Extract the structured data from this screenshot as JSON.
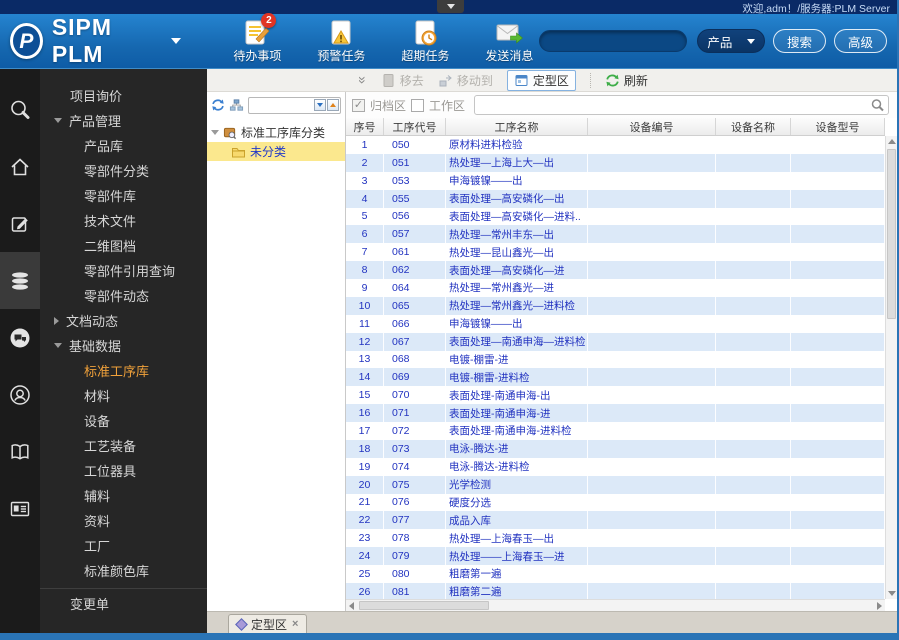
{
  "titlebar": {
    "welcome": "欢迎,adm！/服务器:PLM Server"
  },
  "header": {
    "brand": "SIPM PLM",
    "actions": [
      {
        "name": "todo",
        "label": "待办事项",
        "badge": "2"
      },
      {
        "name": "warning-tasks",
        "label": "预警任务"
      },
      {
        "name": "overdue-tasks",
        "label": "超期任务"
      },
      {
        "name": "send-message",
        "label": "发送消息"
      }
    ],
    "search": {
      "value": "",
      "category": "产品",
      "search_btn": "搜索",
      "advanced_btn": "高级"
    }
  },
  "nav_rail": {
    "active": "database",
    "icons": [
      "sipm-search",
      "home",
      "edit",
      "database",
      "chat",
      "support",
      "book",
      "id-card"
    ]
  },
  "sidebar": {
    "active_item": "标准工序库",
    "items": [
      {
        "label": "项目询价",
        "type": "top"
      },
      {
        "label": "产品管理",
        "type": "group",
        "state": "expanded"
      },
      {
        "label": "产品库",
        "type": "child"
      },
      {
        "label": "零部件分类",
        "type": "child"
      },
      {
        "label": "零部件库",
        "type": "child"
      },
      {
        "label": "技术文件",
        "type": "child"
      },
      {
        "label": "二维图档",
        "type": "child"
      },
      {
        "label": "零部件引用查询",
        "type": "child"
      },
      {
        "label": "零部件动态",
        "type": "child"
      },
      {
        "label": "文档动态",
        "type": "group",
        "state": "collapsed"
      },
      {
        "label": "基础数据",
        "type": "group",
        "state": "expanded"
      },
      {
        "label": "标准工序库",
        "type": "child"
      },
      {
        "label": "材料",
        "type": "child"
      },
      {
        "label": "设备",
        "type": "child"
      },
      {
        "label": "工艺装备",
        "type": "child"
      },
      {
        "label": "工位器具",
        "type": "child"
      },
      {
        "label": "辅料",
        "type": "child"
      },
      {
        "label": "资料",
        "type": "child"
      },
      {
        "label": "工厂",
        "type": "child"
      },
      {
        "label": "标准颜色库",
        "type": "child"
      },
      {
        "label": "变更单",
        "type": "top",
        "separator": true
      }
    ]
  },
  "toolbar": {
    "buttons": [
      {
        "label": "移去",
        "enabled": false
      },
      {
        "label": "移动到",
        "enabled": false
      },
      {
        "label": "定型区",
        "enabled": true,
        "active": true
      },
      {
        "label": "刷新",
        "enabled": true
      }
    ],
    "filters": {
      "archive": {
        "label": "归档区",
        "checked": true,
        "enabled": false
      },
      "workspace": {
        "label": "工作区",
        "checked": false,
        "enabled": true
      }
    }
  },
  "tree": {
    "root": "标准工序库分类",
    "children": [
      {
        "label": "未分类",
        "selected": true
      }
    ]
  },
  "table": {
    "columns": [
      "序号",
      "工序代号",
      "工序名称",
      "设备编号",
      "设备名称",
      "设备型号"
    ],
    "rows": [
      [
        "1",
        "050",
        "原材料进料检验"
      ],
      [
        "2",
        "051",
        "热处理—上海上大—出"
      ],
      [
        "3",
        "053",
        "申海镀镍——出"
      ],
      [
        "4",
        "055",
        "表面处理—高安磷化—出"
      ],
      [
        "5",
        "056",
        "表面处理—高安磷化—进料.."
      ],
      [
        "6",
        "057",
        "热处理—常州丰东—出"
      ],
      [
        "7",
        "061",
        "热处理—昆山鑫光—出"
      ],
      [
        "8",
        "062",
        "表面处理—高安磷化—进"
      ],
      [
        "9",
        "064",
        "热处理—常州鑫光—进"
      ],
      [
        "10",
        "065",
        "热处理—常州鑫光—进料检"
      ],
      [
        "11",
        "066",
        "申海镀镍——出"
      ],
      [
        "12",
        "067",
        "表面处理—南通申海—进料检"
      ],
      [
        "13",
        "068",
        "电镀-棚雷-进"
      ],
      [
        "14",
        "069",
        "电镀-棚雷-进料检"
      ],
      [
        "15",
        "070",
        "表面处理-南通申海-出"
      ],
      [
        "16",
        "071",
        "表面处理-南通申海-进"
      ],
      [
        "17",
        "072",
        "表面处理-南通申海-进料检"
      ],
      [
        "18",
        "073",
        "电泳-腾达-进"
      ],
      [
        "19",
        "074",
        "电泳-腾达-进料检"
      ],
      [
        "20",
        "075",
        "光学检测"
      ],
      [
        "21",
        "076",
        "硬度分选"
      ],
      [
        "22",
        "077",
        "成品入库"
      ],
      [
        "23",
        "078",
        "热处理—上海春玉—出"
      ],
      [
        "24",
        "079",
        "热处理——上海春玉—进"
      ],
      [
        "25",
        "080",
        "粗磨第一遍"
      ],
      [
        "26",
        "081",
        "粗磨第二遍"
      ]
    ]
  },
  "bottom_tab": {
    "label": "定型区",
    "close": "×"
  },
  "colors": {
    "titlebar_navy": "#0a2a66",
    "header_blue_top": "#2584d0",
    "header_blue_bottom": "#0e5ca6",
    "sidebar_bg": "#262626",
    "sidebar_active_text": "#f0a13a",
    "tree_selection_bg": "#fbe88e",
    "row_alt_blue": "#dce9f8",
    "table_text_blue": "#2233c0",
    "badge_red": "#e03424",
    "refresh_green": "#3fae49",
    "frame_blue": "#2a74b6"
  }
}
